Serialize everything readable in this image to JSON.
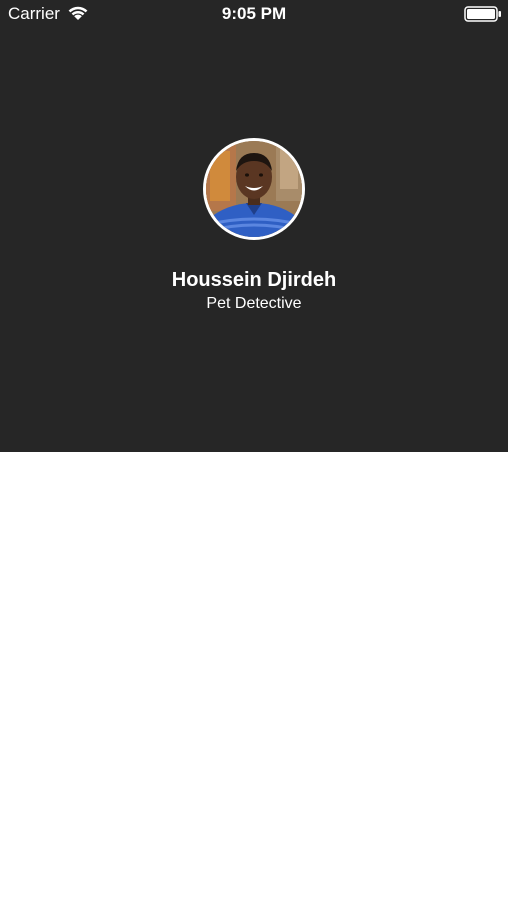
{
  "status_bar": {
    "carrier": "Carrier",
    "time": "9:05 PM",
    "wifi_icon": "wifi-icon",
    "battery_icon": "battery-icon"
  },
  "profile": {
    "name": "Houssein Djirdeh",
    "title": "Pet Detective",
    "avatar_icon": "avatar-photo"
  },
  "colors": {
    "header_background": "#262626",
    "content_background": "#ffffff",
    "text": "#ffffff"
  }
}
